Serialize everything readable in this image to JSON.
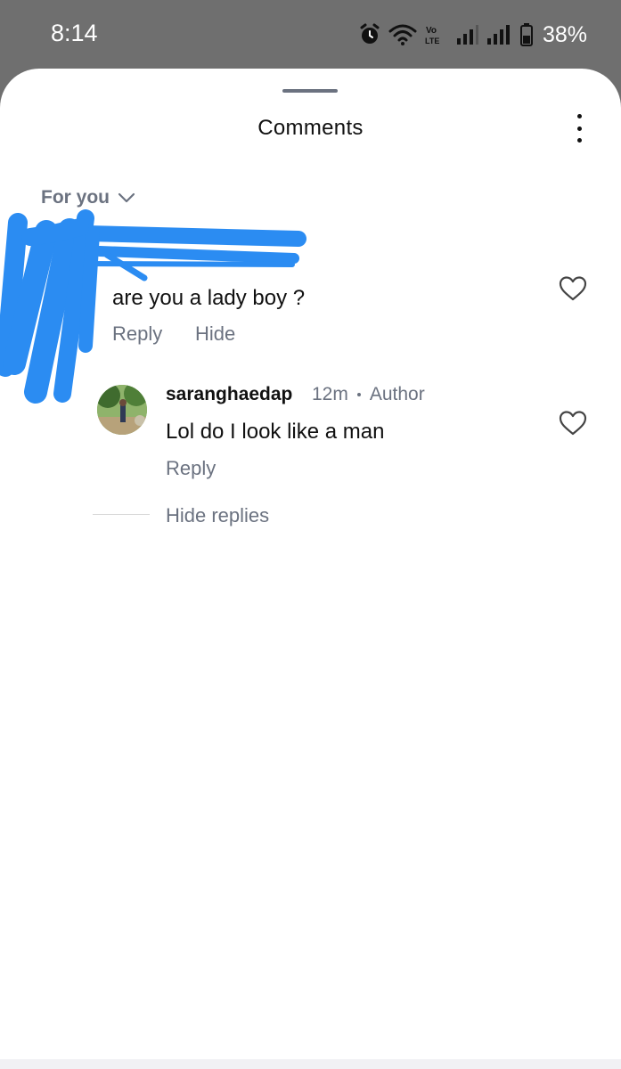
{
  "status_bar": {
    "time": "8:14",
    "network_badge": [
      "Vo",
      "LTE"
    ],
    "battery_percent": "38%"
  },
  "sheet": {
    "title": "Comments",
    "more_icon": "more-vertical-icon",
    "sort_label": "For you",
    "sort_icon": "chevron-down-icon"
  },
  "comment": {
    "text": "are you a lady boy ?",
    "reply_label": "Reply",
    "hide_label": "Hide",
    "like_icon": "heart-outline-icon"
  },
  "reply": {
    "username": "saranghaedap",
    "time": "12m",
    "role_badge": "Author",
    "text": "Lol do I look like a man",
    "reply_label": "Reply",
    "like_icon": "heart-outline-icon"
  },
  "thread": {
    "hide_replies_label": "Hide replies"
  },
  "colors": {
    "status_bar_bg": "#6f6f6f",
    "muted_text": "#6b7280",
    "redaction_blue": "#2b8cf2"
  }
}
